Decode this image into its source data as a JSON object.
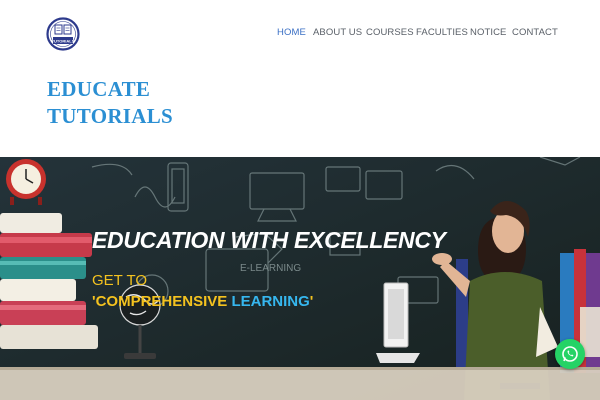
{
  "header": {
    "logo_icon": "educate-tutorials-logo",
    "logo_text": "EDUCATE TUTORIALS",
    "brand_line1": "EDUCATE",
    "brand_line2": "TUTORIALS"
  },
  "nav": {
    "items": [
      {
        "label": "HOME",
        "active": true
      },
      {
        "label": "ABOUT US",
        "active": false
      },
      {
        "label": "COURSES",
        "active": false
      },
      {
        "label": "FACULTIES",
        "active": false
      },
      {
        "label": "NOTICE",
        "active": false
      },
      {
        "label": "CONTACT",
        "active": false
      }
    ]
  },
  "banner": {
    "headline": "EDUCATION WITH EXCELLENCY",
    "subline": "GET TO",
    "tagline_open": "'",
    "tagline_word1": "COMPREHENSIVE",
    "tagline_word2": "LEARNING",
    "tagline_close": "'",
    "chalk_text": "E-LEARNING"
  },
  "floating": {
    "whatsapp_icon": "whatsapp-icon"
  },
  "colors": {
    "nav_active": "#3a6fc4",
    "brand": "#2b8fd3",
    "tagline_yellow": "#f4c21f",
    "tagline_blue": "#36b7ef",
    "banner_bg": "#1e2a2d",
    "whatsapp_green": "#25d366"
  }
}
